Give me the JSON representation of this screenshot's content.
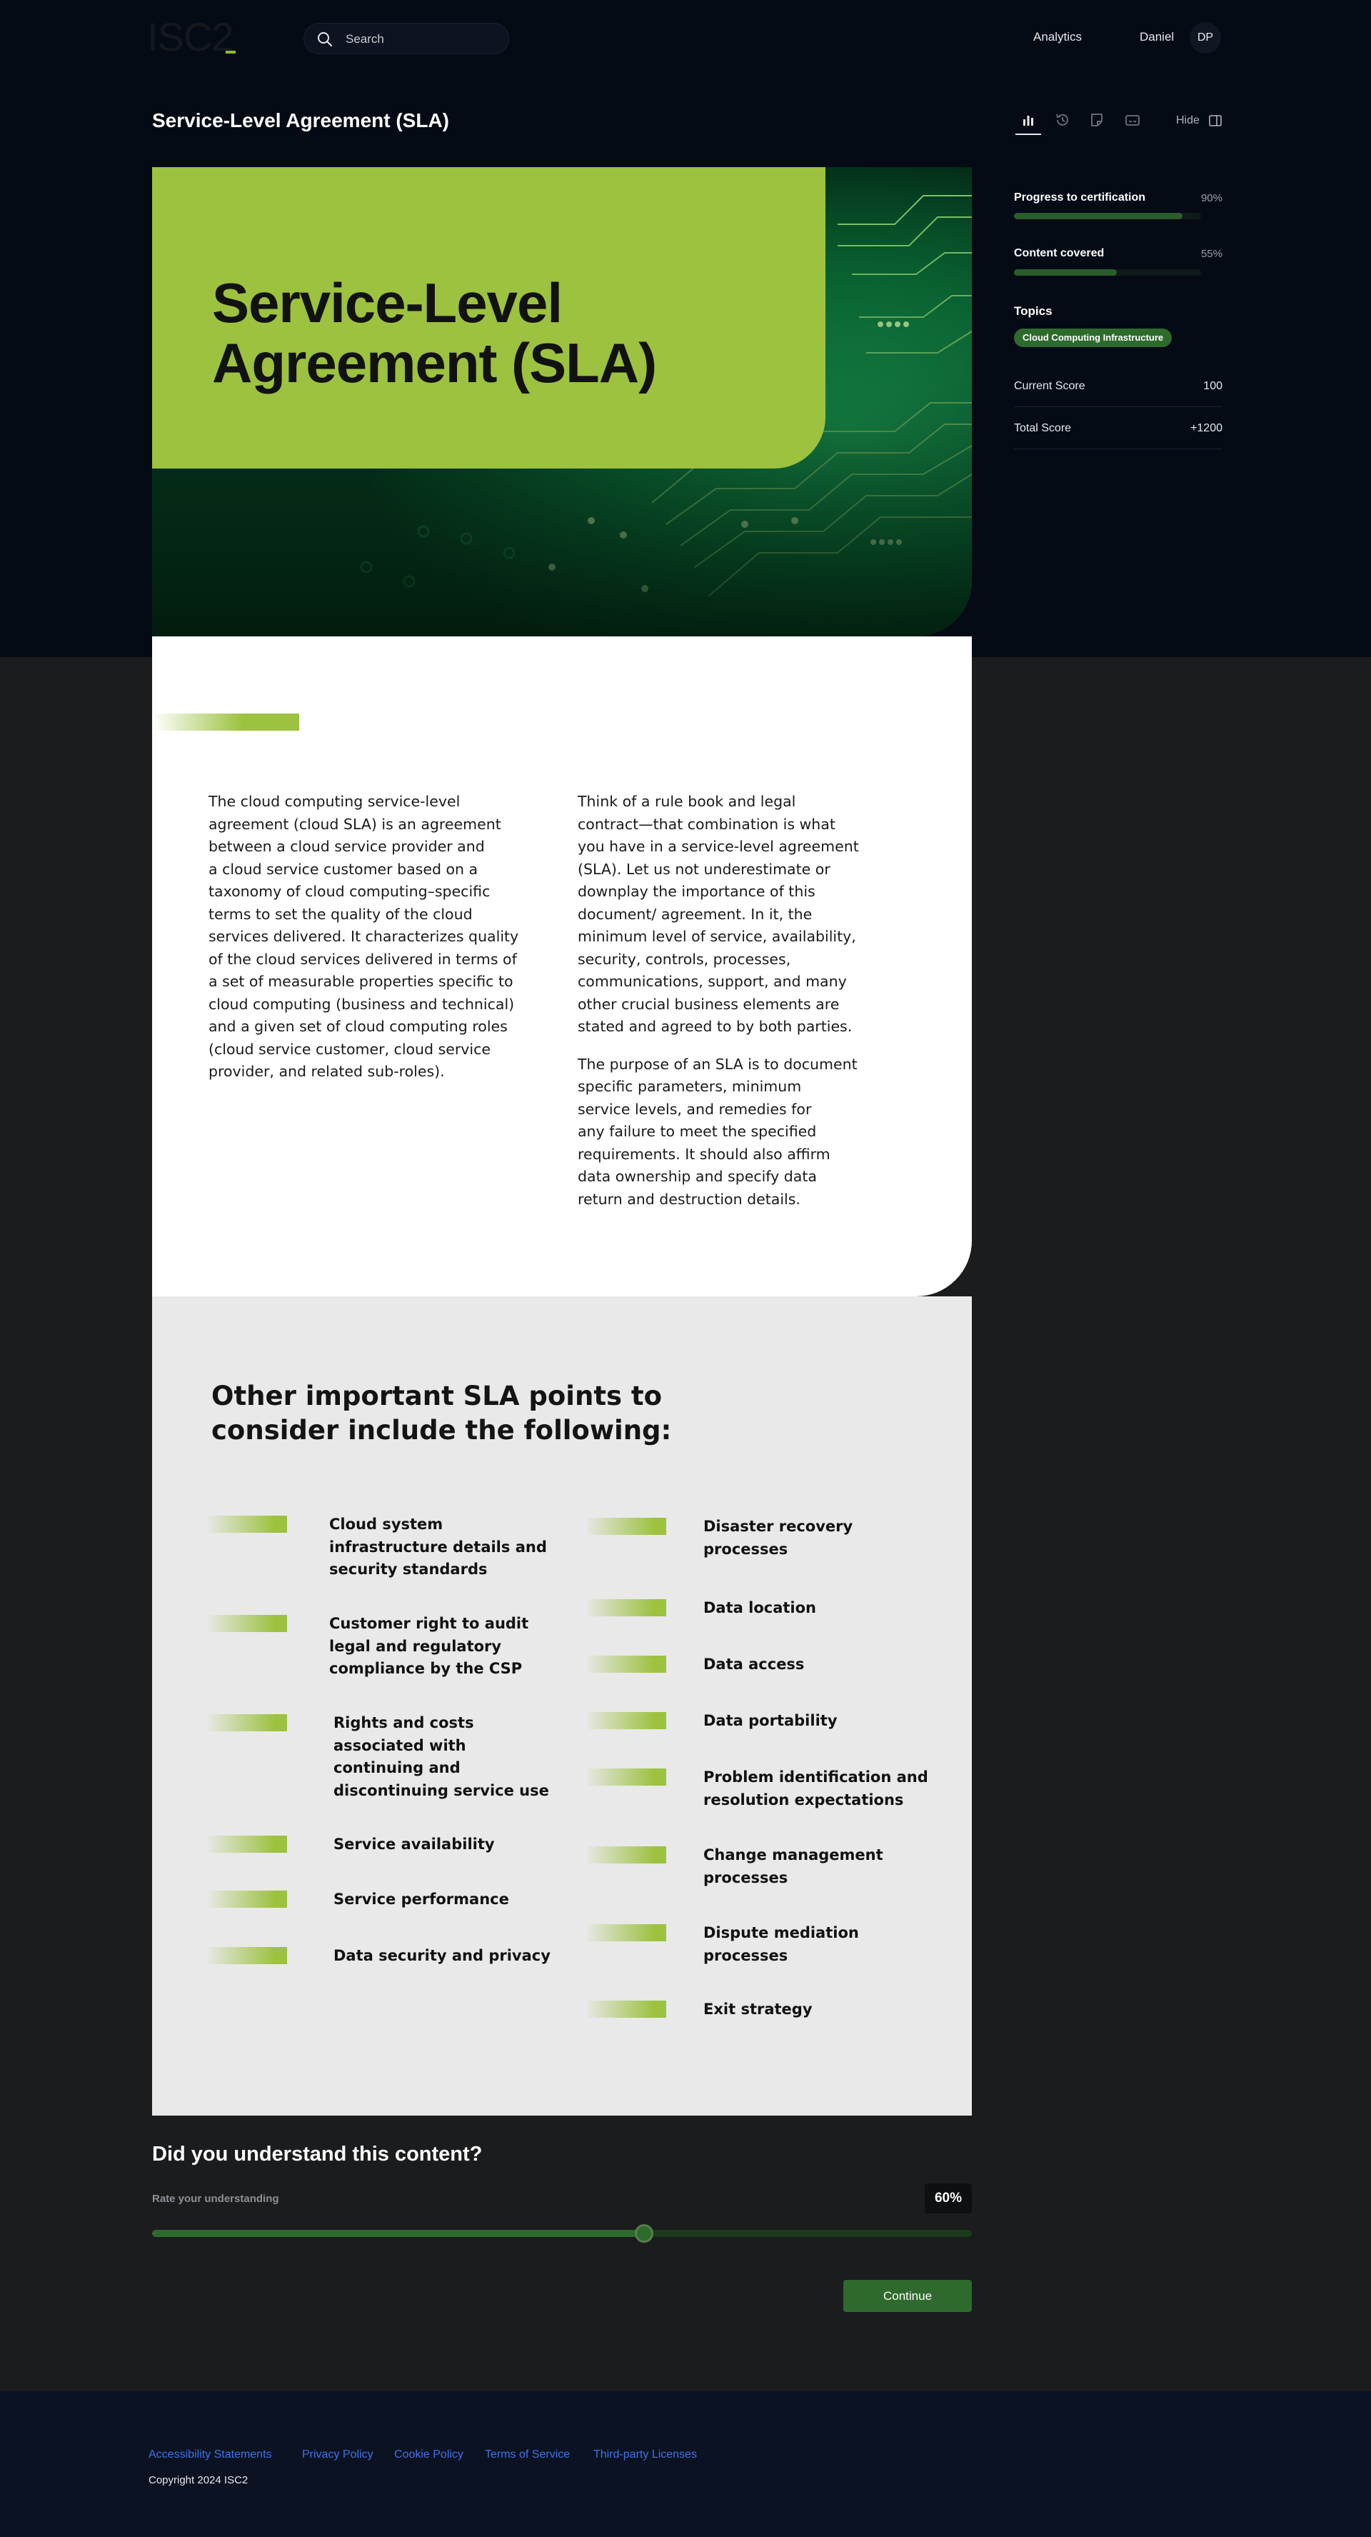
{
  "header": {
    "logo": "ISC2",
    "search_placeholder": "Search",
    "nav_analytics": "Analytics",
    "user_name": "Daniel",
    "user_initials": "DP"
  },
  "page": {
    "title": "Service-Level Agreement (SLA)",
    "hide_label": "Hide",
    "toolbar_icons": [
      "chart-icon",
      "history-icon",
      "note-icon",
      "captions-icon"
    ]
  },
  "sidebar": {
    "progress_label": "Progress to certification",
    "progress_value": "90%",
    "progress_fraction": 0.9,
    "content_label": "Content covered",
    "content_value": "55%",
    "content_fraction": 0.55,
    "topics_label": "Topics",
    "topic": "Cloud Computing Infrastructure",
    "current_score_label": "Current Score",
    "current_score": "100",
    "total_score_label": "Total Score",
    "total_score": "+1200"
  },
  "hero": {
    "title_line1": "Service-Level",
    "title_line2": "Agreement (SLA)"
  },
  "intro": {
    "left_lines": [
      "The cloud computing service-level",
      "agreement (cloud SLA) is an agreement",
      "between a cloud service provider and",
      "a cloud service customer based on a",
      "taxonomy of cloud computing–specific",
      "terms to set the quality of the cloud",
      "services delivered. It characterizes quality",
      "of the cloud services delivered in terms of",
      "a set of measurable properties specific to",
      "cloud computing (business and technical)",
      "and a given set of cloud computing roles",
      "(cloud service customer, cloud service",
      "provider, and related sub-roles)."
    ],
    "right_lines_1": [
      "Think of a rule book and legal",
      "contract—that combination is what",
      "you have in a service-level agreement",
      "(SLA). Let us not underestimate or",
      "downplay the importance of this",
      "document/ agreement. In it, the",
      "minimum level of service, availability,",
      "security, controls, processes,",
      "communications, support, and many",
      "other crucial business elements are",
      "stated and agreed to by both parties."
    ],
    "right_lines_2": [
      "The purpose of an SLA is to document",
      "specific parameters, minimum",
      "service levels, and remedies for",
      "any failure to meet the specified",
      "requirements. It should also affirm",
      "data ownership and specify data",
      "return and destruction details."
    ]
  },
  "points": {
    "heading_line1": "Other important SLA points to",
    "heading_line2": "consider include the following:",
    "left": [
      [
        "Cloud system",
        "infrastructure details and",
        "security standards"
      ],
      [
        "Customer right to audit",
        "legal and regulatory",
        "compliance by the CSP"
      ],
      [
        "Rights and costs",
        "associated with",
        "continuing and",
        "discontinuing service use"
      ],
      [
        "Service availability"
      ],
      [
        "Service performance"
      ],
      [
        "Data security and privacy"
      ]
    ],
    "right": [
      [
        "Disaster recovery",
        "processes"
      ],
      [
        "Data location"
      ],
      [
        "Data access"
      ],
      [
        "Data portability"
      ],
      [
        "Problem identification and",
        "resolution expectations"
      ],
      [
        "Change management",
        "processes"
      ],
      [
        "Dispute mediation",
        "processes"
      ],
      [
        "Exit strategy"
      ]
    ]
  },
  "understand": {
    "title": "Did you understand this content?",
    "rate_label": "Rate your understanding",
    "value": "60%",
    "fraction": 0.6,
    "continue_label": "Continue"
  },
  "footer": {
    "links": [
      "Accessibility Statements",
      "Privacy Policy",
      "Cookie Policy",
      "Terms of Service",
      "Third-party Licenses"
    ],
    "copyright": "Copyright 2024 ISC2"
  },
  "colors": {
    "accent_green": "#9cc23f",
    "button_green": "#2e6a2d",
    "link_blue": "#3f74e6",
    "dark_bg": "#050b15"
  }
}
